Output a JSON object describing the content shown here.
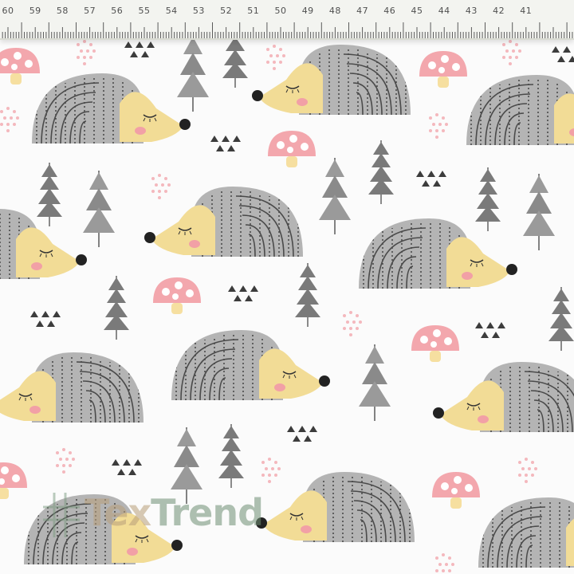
{
  "ruler": {
    "labels": [
      "60",
      "59",
      "58",
      "57",
      "56",
      "55",
      "54",
      "53",
      "52",
      "51",
      "50",
      "49",
      "48",
      "47",
      "46",
      "45",
      "44",
      "43",
      "42",
      "41"
    ]
  },
  "colors": {
    "fabric": "#fbfbfb",
    "hedgehog_body": "#b4b4b4",
    "hedgehog_stripes": "#4a4a4a",
    "hedgehog_face": "#f2dc96",
    "cheek": "#f2a0a6",
    "nose": "#222222",
    "mushroom_cap": "#f3a7ad",
    "mushroom_stem": "#f6dfa0",
    "tree": "#8d8d8d",
    "dots": "#f4b8bd",
    "triangles": "#3c3c3c"
  },
  "pattern": {
    "hedgehog_icon": "hedgehog-icon",
    "mushroom_icon": "mushroom-icon",
    "tree_icon": "pine-tree-icon",
    "dots_icon": "pink-dots-icon",
    "triangles_icon": "triangle-cluster-icon"
  },
  "watermark": {
    "text_part1": "Tex",
    "text_part2": "Trend"
  }
}
